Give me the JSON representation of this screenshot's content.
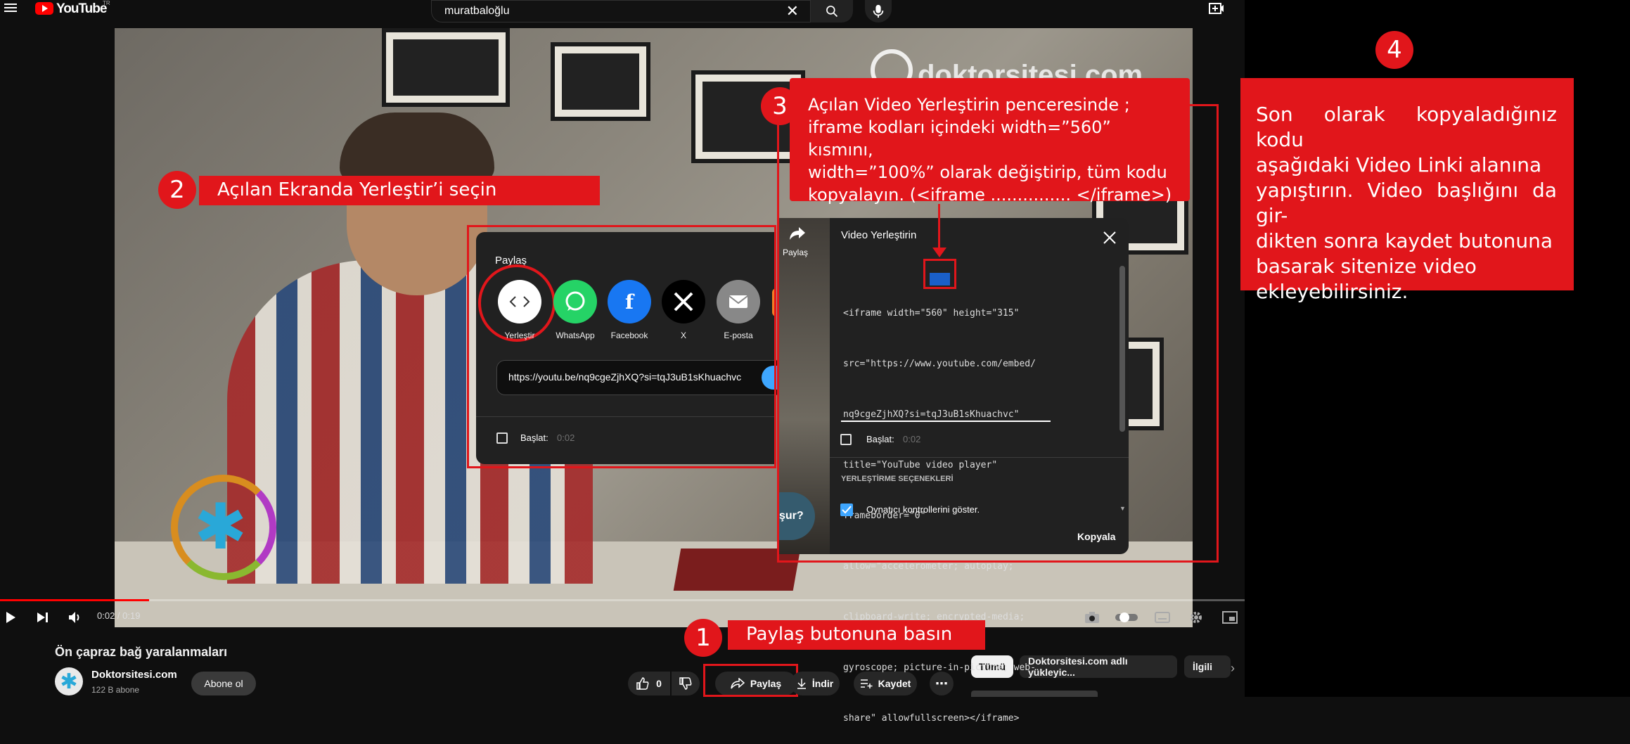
{
  "header": {
    "logo_text": "YouTube",
    "logo_region": "TR",
    "search_value": "muratbaloğlu"
  },
  "player": {
    "watermark": "doktorsitesi.com",
    "time": "0:02 / 0:19",
    "progress": 0.12
  },
  "video": {
    "title": "Ön çapraz bağ yaralanmaları",
    "channel": "Doktorsitesi.com",
    "subscribers": "122 B abone",
    "subscribe_label": "Abone ol",
    "likes": "0",
    "share_label": "Paylaş",
    "download_label": "İndir",
    "save_label": "Kaydet"
  },
  "chips": [
    "Tümü",
    "Doktorsitesi.com adlı yükleyic...",
    "İlgili"
  ],
  "share_dialog": {
    "title": "Paylaş",
    "options": [
      "Yerleştir",
      "WhatsApp",
      "Facebook",
      "X",
      "E-posta"
    ],
    "url": "https://youtu.be/nq9cgeZjhXQ?si=tqJ3uB1sKhuachvc",
    "start_label": "Başlat:",
    "start_time": "0:02"
  },
  "embed_dialog": {
    "side_label": "Paylaş",
    "side_text": "şur?",
    "title": "Video Yerleştirin",
    "code_lines": [
      "<iframe width=\"560\" height=\"315\"",
      "src=\"https://www.youtube.com/embed/",
      "nq9cgeZjhXQ?si=tqJ3uB1sKhuachvc\"",
      "title=\"YouTube video player\"",
      "frameborder=\"0\"",
      "allow=\"accelerometer; autoplay;",
      "clipboard-write; encrypted-media;",
      "gyroscope; picture-in-picture; web-",
      "share\" allowfullscreen></iframe>"
    ],
    "highlight": "560",
    "start_label": "Başlat:",
    "start_time": "0:02",
    "options_heading": "YERLEŞTİRME SEÇENEKLERİ",
    "option1": "Oynatıcı kontrollerini göster.",
    "copy_label": "Kopyala"
  },
  "annotations": {
    "step1_num": "1",
    "step1_text": "Paylaş butonuna basın",
    "step2_num": "2",
    "step2_text": "Açılan Ekranda Yerleştir’i seçin",
    "step3_num": "3",
    "step3_lines": [
      "Açılan Video Yerleştirin penceresinde ;",
      "iframe kodları içindeki width=”560”  kısmını,",
      "width=”100%” olarak değiştirip, tüm kodu",
      "kopyalayın. (<iframe ............... </iframe>)"
    ],
    "step4_num": "4",
    "step4_lines": [
      "Son olarak kopyaladığınız kodu",
      "aşağıdaki Video Linki alanına",
      "yapıştırın. Video başlığını da gir-",
      "dikten sonra kaydet butonuna",
      "basarak sitenize video",
      "ekleyebilirsiniz."
    ]
  },
  "colors": {
    "annotation_red": "#e1161b",
    "youtube_red": "#ff0000",
    "link_blue": "#3ea6ff"
  }
}
